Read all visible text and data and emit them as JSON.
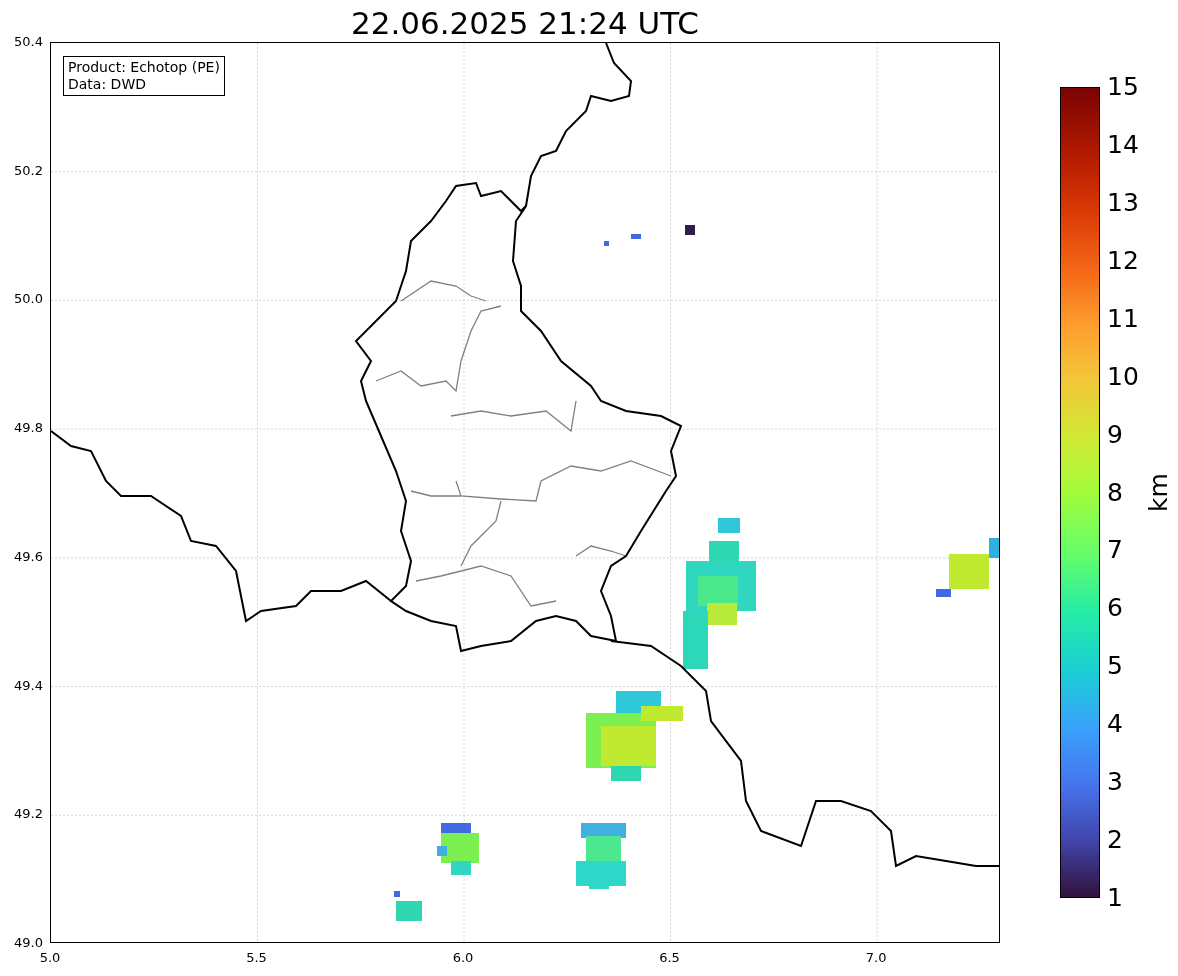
{
  "title": "22.06.2025 21:24 UTC",
  "legend": [
    "Product: Echotop (PE)",
    "Data: DWD"
  ],
  "x_ticks": [
    "5.0",
    "5.5",
    "6.0",
    "6.5",
    "7.0"
  ],
  "y_ticks": [
    "50.4",
    "50.2",
    "50.0",
    "49.8",
    "49.6",
    "49.4",
    "49.2",
    "49.0"
  ],
  "colorbar": {
    "label": "km",
    "ticks": [
      "15",
      "14",
      "13",
      "12",
      "11",
      "10",
      "9",
      "8",
      "7",
      "6",
      "5",
      "4",
      "3",
      "2",
      "1"
    ]
  }
}
